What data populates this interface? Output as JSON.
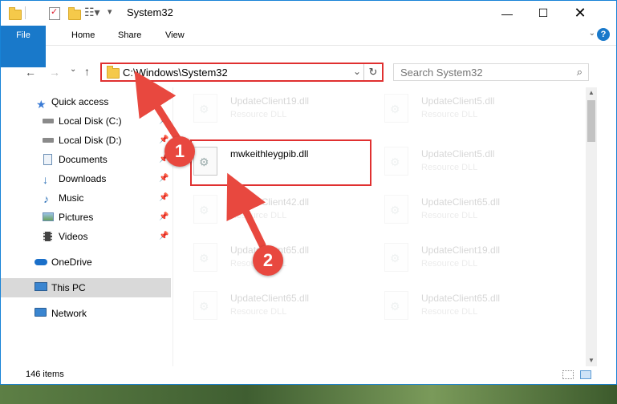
{
  "window": {
    "title": "System32"
  },
  "ribbon": {
    "tabs": [
      "File",
      "Home",
      "Share",
      "View"
    ]
  },
  "address": {
    "path": "C:\\Windows\\System32"
  },
  "search": {
    "placeholder": "Search System32"
  },
  "sidebar": {
    "items": [
      {
        "label": "Quick access",
        "icon": "star-icon",
        "pinned": false,
        "selected": false
      },
      {
        "label": "Local Disk (C:)",
        "icon": "drive-icon",
        "pinned": true,
        "selected": false
      },
      {
        "label": "Local Disk (D:)",
        "icon": "drive-icon",
        "pinned": true,
        "selected": false
      },
      {
        "label": "Documents",
        "icon": "documents-icon",
        "pinned": true,
        "selected": false
      },
      {
        "label": "Downloads",
        "icon": "download-icon",
        "pinned": true,
        "selected": false
      },
      {
        "label": "Music",
        "icon": "music-icon",
        "pinned": true,
        "selected": false
      },
      {
        "label": "Pictures",
        "icon": "pictures-icon",
        "pinned": true,
        "selected": false
      },
      {
        "label": "Videos",
        "icon": "videos-icon",
        "pinned": true,
        "selected": false
      },
      {
        "label": "OneDrive",
        "icon": "cloud-icon",
        "pinned": false,
        "selected": false
      },
      {
        "label": "This PC",
        "icon": "computer-icon",
        "pinned": false,
        "selected": true
      },
      {
        "label": "Network",
        "icon": "network-icon",
        "pinned": false,
        "selected": false
      }
    ]
  },
  "files": [
    {
      "name": "UpdateClient19.dll",
      "type": "Resource DLL",
      "faded": true
    },
    {
      "name": "UpdateClient5.dll",
      "type": "Resource DLL",
      "faded": true
    },
    {
      "name": "mwkeithleygpib.dll",
      "type": "",
      "faded": false
    },
    {
      "name": "UpdateClient5.dll",
      "type": "Resource DLL",
      "faded": true
    },
    {
      "name": "UpdateClient42.dll",
      "type": "Resource DLL",
      "faded": true
    },
    {
      "name": "UpdateClient65.dll",
      "type": "Resource DLL",
      "faded": true
    },
    {
      "name": "UpdateClient65.dll",
      "type": "Resource DLL",
      "faded": true
    },
    {
      "name": "UpdateClient19.dll",
      "type": "Resource DLL",
      "faded": true
    },
    {
      "name": "UpdateClient65.dll",
      "type": "Resource DLL",
      "faded": true
    },
    {
      "name": "UpdateClient65.dll",
      "type": "Resource DLL",
      "faded": true
    }
  ],
  "annotations": {
    "step1": "1",
    "step2": "2",
    "color": "#e8483f"
  },
  "status": {
    "item_count": "146 items"
  },
  "colors": {
    "accent": "#1979ca",
    "highlight": "#e03030"
  }
}
